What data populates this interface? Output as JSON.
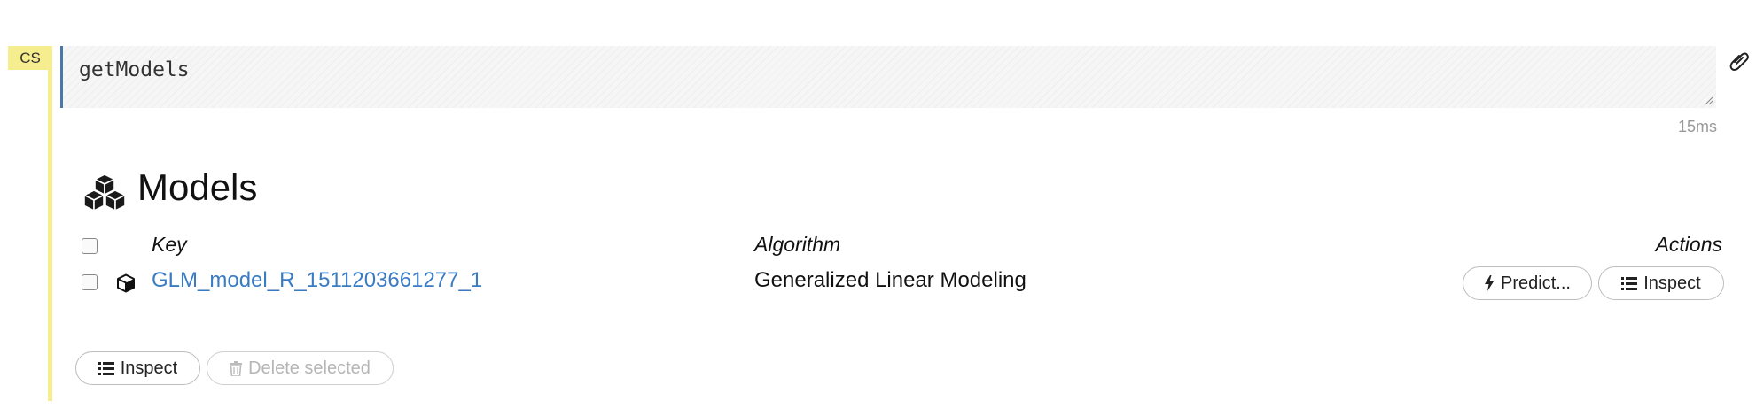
{
  "cell": {
    "type_label": "CS",
    "code": "getModels",
    "timing": "15ms"
  },
  "output": {
    "title": "Models",
    "columns": {
      "key": "Key",
      "algorithm": "Algorithm",
      "actions": "Actions"
    },
    "rows": [
      {
        "key": "GLM_model_R_1511203661277_1",
        "algorithm": "Generalized Linear Modeling",
        "predict_label": "Predict...",
        "inspect_label": "Inspect",
        "selected": false
      }
    ],
    "footer": {
      "inspect_label": "Inspect",
      "delete_label": "Delete selected"
    }
  },
  "colors": {
    "cell_accent": "#f6ed8e",
    "editor_border": "#4a78a8",
    "link": "#3a7cc4",
    "muted": "#999999"
  }
}
